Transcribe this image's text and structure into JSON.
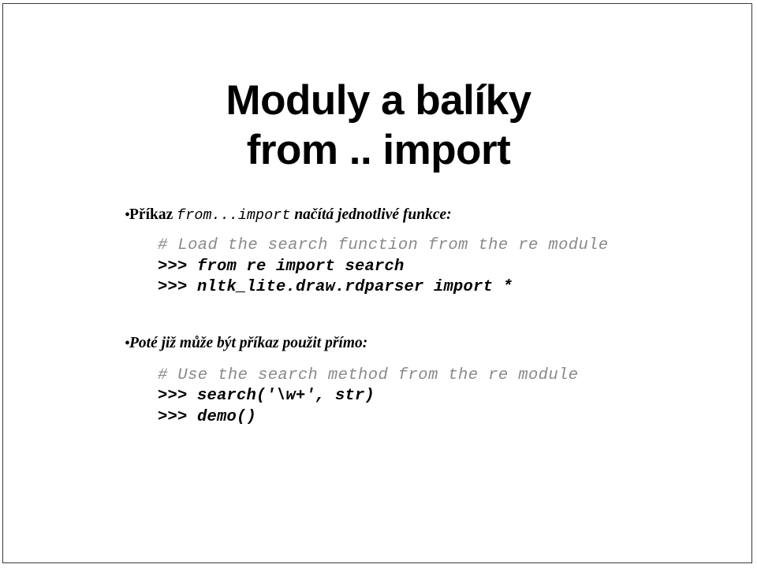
{
  "slide": {
    "title_lines": [
      "Moduly a balíky",
      "from .. import"
    ],
    "bullet_glyph": "•",
    "bullets": [
      {
        "id": "bullet-1",
        "segments": {
          "strong": "Příkaz ",
          "mono": "from...import",
          "italic": " načítá jednotlivé funkce:"
        }
      },
      {
        "id": "bullet-2",
        "segments": {
          "strong": "",
          "mono": "",
          "italic": "Poté již může být příkaz použit přímo:"
        }
      }
    ],
    "code_block_1": [
      {
        "type": "comment",
        "text": "# Load the search function from the re module"
      },
      {
        "type": "prompt",
        "text": ">>> from re import search"
      },
      {
        "type": "prompt",
        "text": ">>> nltk_lite.draw.rdparser import *"
      }
    ],
    "code_block_2": [
      {
        "type": "comment",
        "text": "# Use the search method from the re module"
      },
      {
        "type": "prompt",
        "text": ">>> search('\\w+', str)"
      },
      {
        "type": "prompt",
        "text": ">>> demo()"
      }
    ],
    "colors": {
      "background": "#ffffff",
      "text": "#000000",
      "comment": "#8a8a8a",
      "frame": "#3a3a3a"
    }
  }
}
